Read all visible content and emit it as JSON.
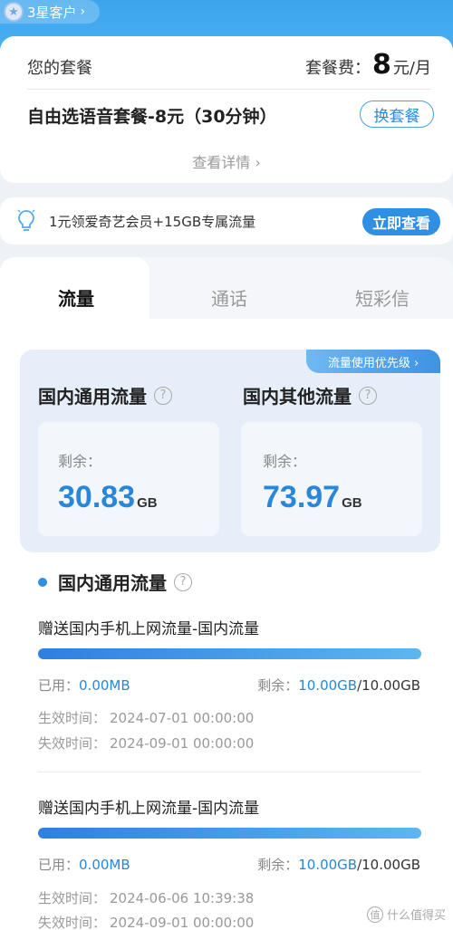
{
  "badge": {
    "label": "3星客户",
    "chevron": "›"
  },
  "plan": {
    "label": "您的套餐",
    "fee_label": "套餐费：",
    "fee_amount": "8",
    "fee_unit": "元/月",
    "name": "自由选语音套餐-8元（30分钟）",
    "switch_label": "换套餐",
    "detail_label": "查看详情 ›"
  },
  "promo": {
    "text": "1元领爱奇艺会员+15GB专属流量",
    "button_label": "立即查看",
    "icon": "lightbulb-icon"
  },
  "tabs": [
    {
      "label": "流量",
      "active": true
    },
    {
      "label": "通话",
      "active": false
    },
    {
      "label": "短彩信",
      "active": false
    }
  ],
  "usage": {
    "priority_label": "流量使用优先级 ›",
    "general": {
      "title": "国内通用流量",
      "remain_label": "剩余：",
      "value": "30.83",
      "unit": "GB"
    },
    "other": {
      "title": "国内其他流量",
      "remain_label": "剩余：",
      "value": "73.97",
      "unit": "GB"
    }
  },
  "section": {
    "title": "国内通用流量"
  },
  "packages": [
    {
      "title": "赠送国内手机上网流量-国内流量",
      "used_label": "已用：",
      "used_value": "0.00MB",
      "remain_label": "剩余：",
      "remain_value": "10.00GB",
      "total": "/10.00GB",
      "remaining_fraction": 1.0,
      "start_label": "生效时间：",
      "start": "2024-07-01 00:00:00",
      "end_label": "失效时间：",
      "end": "2024-09-01 00:00:00"
    },
    {
      "title": "赠送国内手机上网流量-国内流量",
      "used_label": "已用：",
      "used_value": "0.00MB",
      "remain_label": "剩余：",
      "remain_value": "10.00GB",
      "total": "/10.00GB",
      "remaining_fraction": 1.0,
      "start_label": "生效时间：",
      "start": "2024-06-06 10:39:38",
      "end_label": "失效时间：",
      "end": "2024-09-01 00:00:00"
    }
  ],
  "watermark": {
    "text": "什么值得买",
    "icon_char": "值"
  },
  "colors": {
    "accent": "#2f8fe2",
    "value_blue": "#2a86d8",
    "header": "#3aa5ee"
  }
}
